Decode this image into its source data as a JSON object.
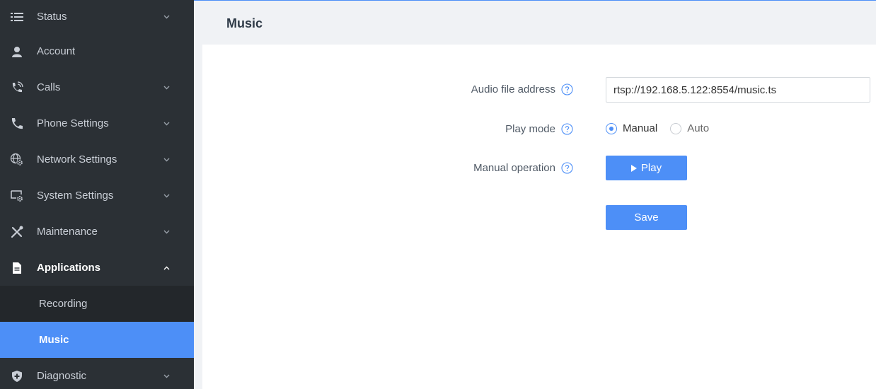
{
  "sidebar": {
    "items": [
      {
        "label": "Status",
        "icon": "list-icon"
      },
      {
        "label": "Account",
        "icon": "user-icon"
      },
      {
        "label": "Calls",
        "icon": "phone-ring-icon"
      },
      {
        "label": "Phone Settings",
        "icon": "phone-icon"
      },
      {
        "label": "Network Settings",
        "icon": "network-gear-icon"
      },
      {
        "label": "System Settings",
        "icon": "monitor-gear-icon"
      },
      {
        "label": "Maintenance",
        "icon": "tools-icon"
      },
      {
        "label": "Applications",
        "icon": "document-icon"
      },
      {
        "label": "Diagnostic",
        "icon": "shield-icon"
      }
    ],
    "sub_items": [
      {
        "label": "Recording"
      },
      {
        "label": "Music"
      }
    ]
  },
  "page": {
    "title": "Music"
  },
  "form": {
    "audio_label": "Audio file address",
    "audio_value": "rtsp://192.168.5.122:8554/music.ts",
    "play_mode_label": "Play mode",
    "play_mode_options": [
      "Manual",
      "Auto"
    ],
    "play_mode_selected": "Manual",
    "manual_op_label": "Manual operation",
    "play_button": "Play",
    "save_button": "Save"
  },
  "colors": {
    "accent": "#4d8ff7",
    "sidebar_bg": "#2b3035",
    "sub_bg": "#23272b"
  }
}
